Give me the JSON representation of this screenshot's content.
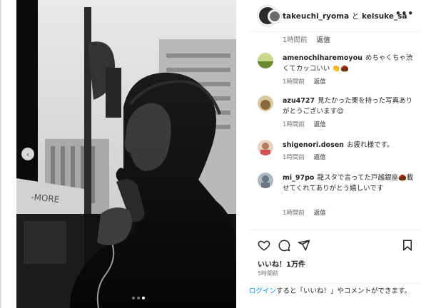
{
  "header": {
    "user1": "takeuchi_ryoma",
    "connector": "と",
    "user2": "keisuke_sakai.s",
    "more_icon": "more-horizontal-icon"
  },
  "top_meta": {
    "time": "1時間前",
    "reply": "返信"
  },
  "comments": [
    {
      "username": "amenochiharemoyou",
      "text": "めちゃくちゃ渋くてカッコいい 👏🌰",
      "time": "1時間前",
      "reply": "返信",
      "avatar_color": "#8fa24a"
    },
    {
      "username": "azu4727",
      "text": "見たかった栗を持った写真ありがとうございます😊",
      "time": "1時間前",
      "reply": "返信",
      "avatar_color": "#b39a6a"
    },
    {
      "username": "shigenori.dosen",
      "text": "お疲れ様です。",
      "time": "1時間前",
      "reply": "返信",
      "avatar_color": "#c9a58a"
    },
    {
      "username": "mi_97po",
      "text": "龍スタで言ってた戸越銀座🌰載せてくれてありがとう嬉しいです",
      "time": "1時間前",
      "reply": "返信",
      "avatar_color": "#7a8a96"
    }
  ],
  "actions": {
    "like_icon": "heart-icon",
    "comment_icon": "comment-icon",
    "share_icon": "share-icon",
    "save_icon": "bookmark-icon"
  },
  "likes": "いいね！1万件",
  "post_time": "5時間前",
  "login": {
    "link": "ログイン",
    "rest": "すると「いいね！」やコメントができます。"
  },
  "carousel": {
    "prev_icon": "chevron-left-icon",
    "dot_count": 3,
    "active_dot": 2
  }
}
